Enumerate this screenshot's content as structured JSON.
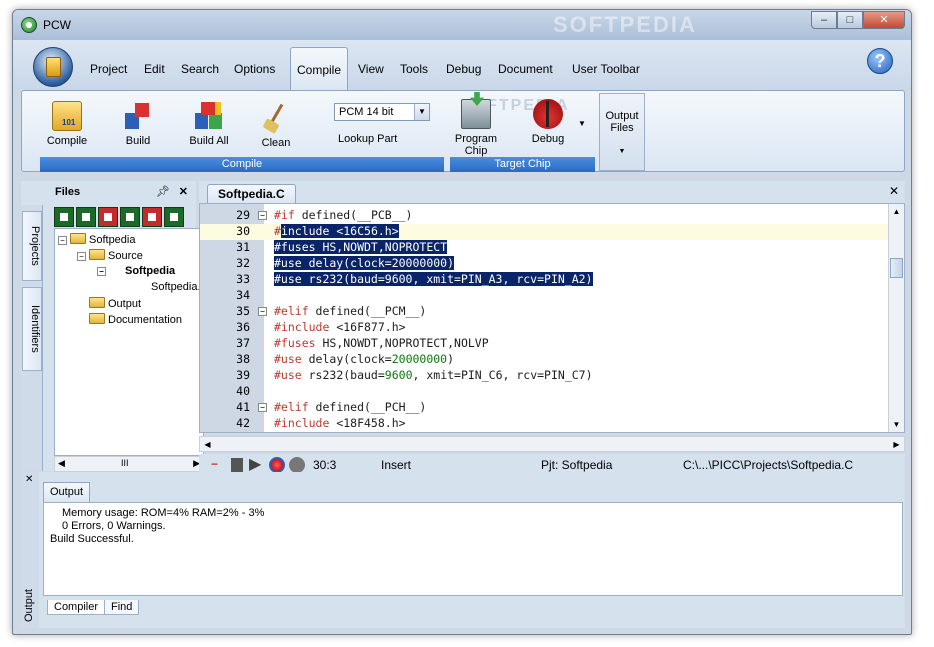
{
  "window": {
    "title": "PCW",
    "watermark": "SOFTPEDIA"
  },
  "ribbon_tabs": [
    "Project",
    "Edit",
    "Search",
    "Options",
    "Compile",
    "View",
    "Tools",
    "Debug",
    "Document",
    "User Toolbar"
  ],
  "active_tab": "Compile",
  "compile_group": {
    "label": "Compile",
    "buttons": [
      {
        "label": "Compile",
        "icon": "compile-icon"
      },
      {
        "label": "Build",
        "icon": "build-icon"
      },
      {
        "label": "Build All",
        "icon": "build-all-icon"
      },
      {
        "label": "Clean",
        "icon": "broom-icon"
      }
    ],
    "compiler_select": "PCM 14 bit",
    "lookup_part": "Lookup Part"
  },
  "target_group": {
    "label": "Target Chip",
    "program_chip": "Program Chip",
    "debug": "Debug"
  },
  "output_files": {
    "label": "Output Files",
    "arrow": "▼"
  },
  "files_panel": {
    "title": "Files",
    "side_tabs": [
      "Projects",
      "Identifiers"
    ],
    "tree": {
      "root": "Softpedia",
      "source": "Source",
      "project": "Softpedia",
      "file": "Softpedia.c",
      "output": "Output",
      "documentation": "Documentation"
    },
    "scroll_label": "III"
  },
  "editor": {
    "tab": "Softpedia.C",
    "lines": [
      {
        "n": "29",
        "fold": "−",
        "segments": [
          {
            "t": "#if ",
            "c": "pp"
          },
          {
            "t": "defined(__PCB__)",
            "c": "kw"
          }
        ]
      },
      {
        "n": "30",
        "current": true,
        "segments": [
          {
            "t": "#",
            "c": "pp"
          },
          {
            "t": "include <16C56.h>",
            "c": "sel"
          }
        ]
      },
      {
        "n": "31",
        "segments": [
          {
            "t": "#fuses HS,NOWDT,NOPROTECT",
            "c": "sel"
          }
        ]
      },
      {
        "n": "32",
        "segments": [
          {
            "t": "#use delay(clock=20000000)",
            "c": "sel"
          }
        ]
      },
      {
        "n": "33",
        "segments": [
          {
            "t": "#use rs232(baud=9600, xmit=PIN_A3, rcv=PIN_A2)",
            "c": "sel"
          }
        ]
      },
      {
        "n": "34",
        "segments": []
      },
      {
        "n": "35",
        "fold": "−",
        "segments": [
          {
            "t": "#elif ",
            "c": "pp"
          },
          {
            "t": "defined(__PCM__)",
            "c": "kw"
          }
        ]
      },
      {
        "n": "36",
        "segments": [
          {
            "t": "#include ",
            "c": "pp"
          },
          {
            "t": "<16F877.h>",
            "c": "kw"
          }
        ]
      },
      {
        "n": "37",
        "segments": [
          {
            "t": "#fuses ",
            "c": "pp"
          },
          {
            "t": "HS,NOWDT,NOPROTECT,NOLVP",
            "c": "kw"
          }
        ]
      },
      {
        "n": "38",
        "segments": [
          {
            "t": "#use ",
            "c": "pp"
          },
          {
            "t": "delay(clock=",
            "c": "kw"
          },
          {
            "t": "20000000",
            "c": "num"
          },
          {
            "t": ")",
            "c": "kw"
          }
        ]
      },
      {
        "n": "39",
        "segments": [
          {
            "t": "#use ",
            "c": "pp"
          },
          {
            "t": "rs232(baud=",
            "c": "kw"
          },
          {
            "t": "9600",
            "c": "num"
          },
          {
            "t": ", xmit=PIN_C6, rcv=PIN_C7)",
            "c": "kw"
          }
        ]
      },
      {
        "n": "40",
        "segments": []
      },
      {
        "n": "41",
        "fold": "−",
        "segments": [
          {
            "t": "#elif ",
            "c": "pp"
          },
          {
            "t": "defined(__PCH__)",
            "c": "kw"
          }
        ]
      },
      {
        "n": "42",
        "segments": [
          {
            "t": "#include ",
            "c": "pp"
          },
          {
            "t": "<18F458.h>",
            "c": "kw"
          }
        ]
      }
    ]
  },
  "status": {
    "position": "30:3",
    "mode": "Insert",
    "project": "Pjt: Softpedia",
    "path": "C:\\...\\PICC\\Projects\\Softpedia.C"
  },
  "output": {
    "tab": "Output",
    "side_label": "Output",
    "lines": [
      "Memory usage:   ROM=4%      RAM=2% - 3%",
      "0 Errors,  0 Warnings.",
      "Build Successful."
    ],
    "bottom_tabs": [
      "Compiler",
      "Find"
    ]
  }
}
